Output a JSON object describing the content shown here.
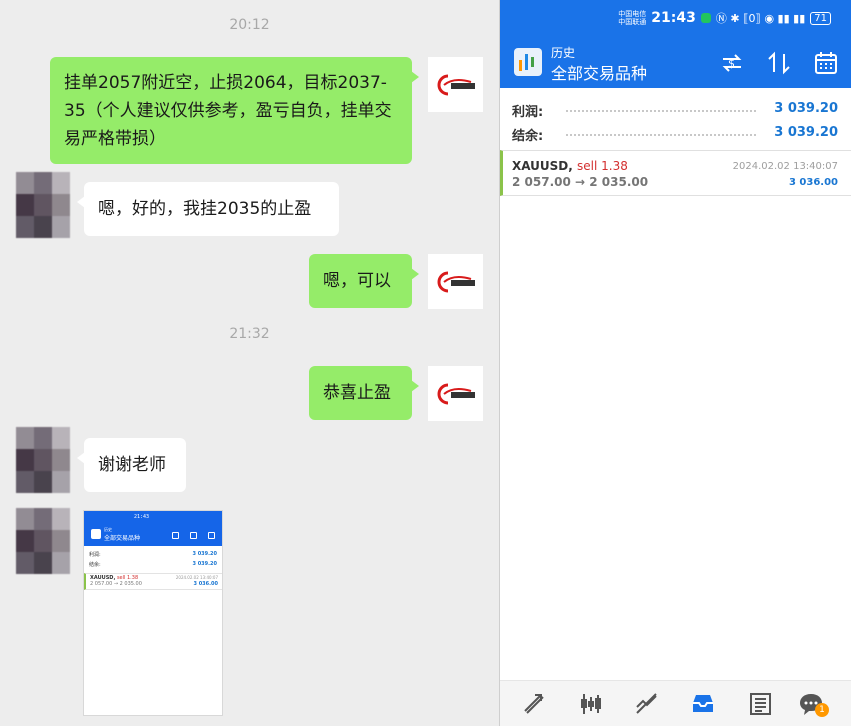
{
  "chat": {
    "times": [
      "20:12",
      "21:32"
    ],
    "messages": [
      {
        "dir": "out",
        "text": "挂单2057附近空，止损2064，目标2037-35（个人建议仅供参考，盈亏自负，挂单交易严格带损）"
      },
      {
        "dir": "in",
        "text": "嗯，好的，我挂2035的止盈"
      },
      {
        "dir": "out",
        "text": "嗯，可以"
      },
      {
        "dir": "out",
        "text": "恭喜止盈"
      },
      {
        "dir": "in",
        "text": "谢谢老师"
      }
    ],
    "thumb": {
      "status": "21:43",
      "sub": "历史",
      "title": "全部交易品种",
      "profit_label": "利润:",
      "profit_value": "3 039.20",
      "balance_label": "结余:",
      "balance_value": "3 039.20",
      "symbol": "XAUUSD,",
      "type": "sell 1.38",
      "time": "2024.02.02 13:40:07",
      "prices": "2 057.00 → 2 035.00",
      "deal_profit": "3 036.00"
    }
  },
  "mt5": {
    "status_bar": {
      "carrier1": "中国电信",
      "carrier2": "中国联通",
      "clock": "21:43",
      "icons": "Ⓝ ✱ ⟦0⟧ ◉ ▮▮ ▮▮",
      "battery": "71"
    },
    "header": {
      "subtitle": "历史",
      "title": "全部交易品种"
    },
    "toolbar_icons": [
      "dollar-swap-icon",
      "sort-icon",
      "calendar-icon"
    ],
    "summary": [
      {
        "label": "利润:",
        "value": "3 039.20"
      },
      {
        "label": "结余:",
        "value": "3 039.20"
      }
    ],
    "deal": {
      "symbol": "XAUUSD,",
      "type": "sell 1.38",
      "open_close": "2 057.00 → 2 035.00",
      "time": "2024.02.02 13:40:07",
      "profit": "3 036.00"
    },
    "bottom_nav": [
      "quotes-icon",
      "chart-icon",
      "trade-icon",
      "history-icon",
      "news-icon",
      "messages-icon"
    ],
    "active_nav": "history-icon",
    "messages_badge": "1",
    "colors": {
      "accent": "#1a73e8",
      "sell": "#d32f2f",
      "profit": "#1976d2",
      "deal_marker": "#8bc34a"
    }
  }
}
